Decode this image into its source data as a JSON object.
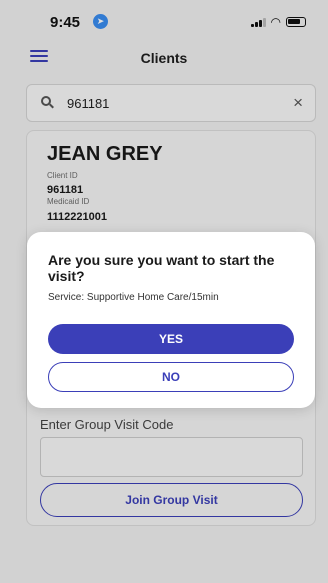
{
  "status_bar": {
    "time": "9:45"
  },
  "nav": {
    "title": "Clients"
  },
  "search": {
    "value": "961181",
    "clear_symbol": "×"
  },
  "client": {
    "name": "JEAN GREY",
    "client_id_label": "Client ID",
    "client_id": "961181",
    "medicaid_id_label": "Medicaid ID",
    "medicaid_id": "1112221001"
  },
  "group_visit": {
    "label": "Enter Group Visit Code",
    "code_value": "",
    "join_label": "Join Group Visit"
  },
  "dialog": {
    "title": "Are you sure you want to start the visit?",
    "service": "Service: Supportive Home Care/15min",
    "yes_label": "YES",
    "no_label": "NO"
  },
  "colors": {
    "accent": "#3b3fb8",
    "location_badge": "#3a8df0"
  },
  "icons": [
    "location-arrow-icon",
    "signal-icon",
    "wifi-icon",
    "battery-icon",
    "hamburger-menu-icon",
    "search-icon",
    "clear-icon"
  ]
}
